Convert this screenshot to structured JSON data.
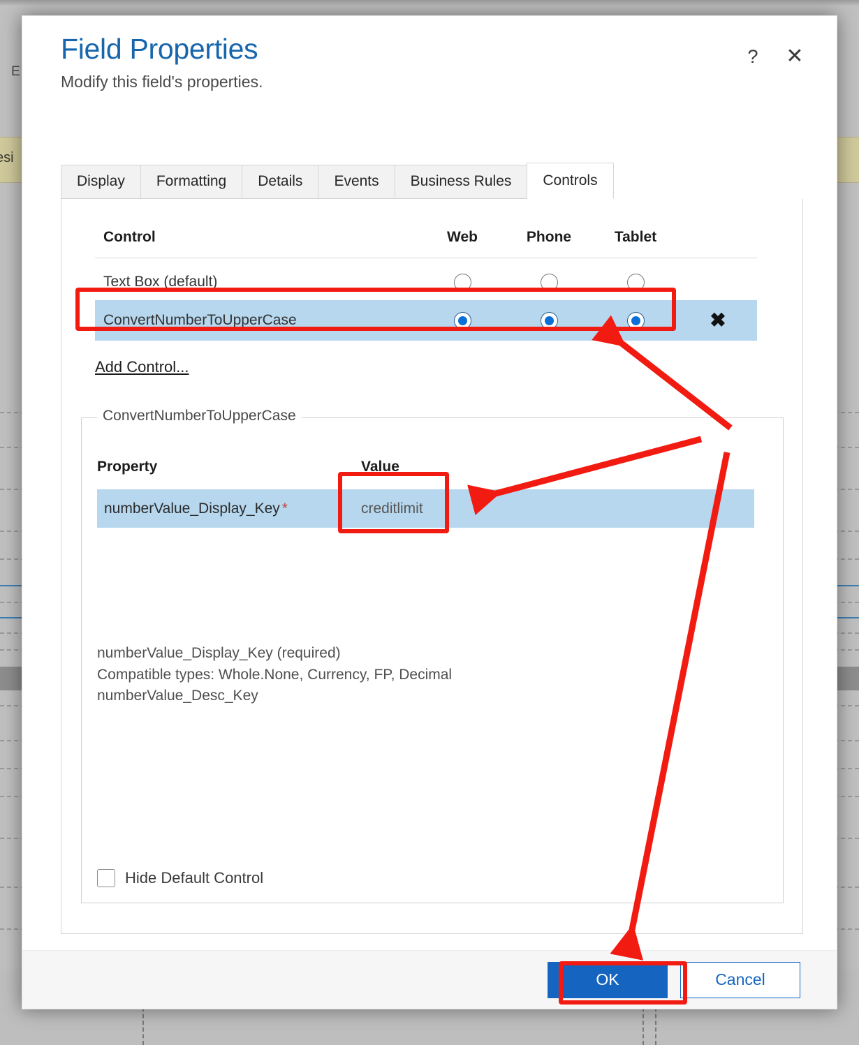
{
  "background": {
    "label_left": "E",
    "label_khaki": "esi"
  },
  "dialog": {
    "title": "Field Properties",
    "subtitle": "Modify this field's properties.",
    "help_icon": "?",
    "close_icon": "✕"
  },
  "tabs": [
    {
      "label": "Display",
      "active": false
    },
    {
      "label": "Formatting",
      "active": false
    },
    {
      "label": "Details",
      "active": false
    },
    {
      "label": "Events",
      "active": false
    },
    {
      "label": "Business Rules",
      "active": false
    },
    {
      "label": "Controls",
      "active": true
    }
  ],
  "controls_table": {
    "headers": {
      "control": "Control",
      "web": "Web",
      "phone": "Phone",
      "tablet": "Tablet"
    },
    "rows": [
      {
        "name": "Text Box (default)",
        "web": false,
        "phone": false,
        "tablet": false,
        "selected": false,
        "deletable": false
      },
      {
        "name": "ConvertNumberToUpperCase",
        "web": true,
        "phone": true,
        "tablet": true,
        "selected": true,
        "deletable": true,
        "delete_icon": "✖"
      }
    ],
    "add_control_label": "Add Control..."
  },
  "properties_panel": {
    "legend": "ConvertNumberToUpperCase",
    "headers": {
      "property": "Property",
      "value": "Value"
    },
    "rows": [
      {
        "property": "numberValue_Display_Key",
        "required_marker": "*",
        "value": "creditlimit"
      }
    ],
    "description_lines": [
      "numberValue_Display_Key (required)",
      "Compatible types: Whole.None, Currency, FP, Decimal",
      "numberValue_Desc_Key"
    ],
    "hide_default_control_label": "Hide Default Control",
    "hide_default_control_checked": false
  },
  "footer": {
    "ok_label": "OK",
    "cancel_label": "Cancel"
  },
  "colors": {
    "title_blue": "#1566ad",
    "selection_blue": "#b6d7ee",
    "radio_blue": "#0a6fd6",
    "primary_button": "#1565c0",
    "annotation_red": "#f21b12",
    "required_star": "#c5413d",
    "backdrop_khaki": "#cfc99b"
  }
}
